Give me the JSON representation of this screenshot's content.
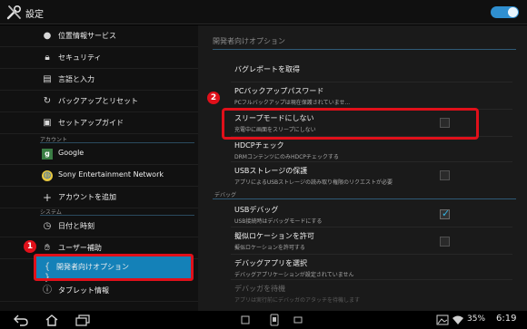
{
  "app": {
    "title": "設定",
    "icon": "wrench-screwdriver-icon",
    "master_switch": "on"
  },
  "colors": {
    "accent": "#1481b8",
    "highlight": "#e0101a",
    "toggle": "#2f8fd0"
  },
  "sidebar": {
    "items": [
      {
        "label": "位置情報サービス",
        "icon": "location-pin-icon"
      },
      {
        "label": "セキュリティ",
        "icon": "lock-icon"
      },
      {
        "label": "言語と入力",
        "icon": "keyboard-icon"
      },
      {
        "label": "バックアップとリセット",
        "icon": "reset-icon"
      },
      {
        "label": "セットアップガイド",
        "icon": "guide-icon"
      }
    ],
    "section_account": "アカウント",
    "account_items": [
      {
        "label": "Google",
        "icon": "google-icon"
      },
      {
        "label": "Sony Entertainment Network",
        "icon": "sony-network-icon"
      },
      {
        "label": "アカウントを追加",
        "icon": "plus-icon"
      }
    ],
    "section_system": "システム",
    "system_items": [
      {
        "label": "日付と時刻",
        "icon": "clock-icon"
      },
      {
        "label": "ユーザー補助",
        "icon": "hand-icon"
      },
      {
        "label": "開発者向けオプション",
        "icon": "braces-icon",
        "selected": true
      },
      {
        "label": "タブレット情報",
        "icon": "info-icon"
      }
    ]
  },
  "content": {
    "heading": "開発者向けオプション",
    "items": [
      {
        "title": "バグレポートを取得",
        "summary": ""
      },
      {
        "title": "PCバックアップパスワード",
        "summary": "PCフルバックアップは現在保護されていませ..."
      },
      {
        "title": "スリープモードにしない",
        "summary": "充電中に画面をスリープにしない",
        "checked": false
      },
      {
        "title": "HDCPチェック",
        "summary": "DRMコンテンツにのみHDCPチェックする"
      },
      {
        "title": "USBストレージの保護",
        "summary": "アプリによるUSBストレージの読み取り権限のリクエストが必要",
        "checked": false
      }
    ],
    "section_debug": "デバッグ",
    "debug_items": [
      {
        "title": "USBデバッグ",
        "summary": "USB接続時はデバッグモードにする",
        "checked": true
      },
      {
        "title": "擬似ロケーションを許可",
        "summary": "擬似ロケーションを許可する",
        "checked": false
      },
      {
        "title": "デバッグアプリを選択",
        "summary": "デバッグアプリケーションが設定されていません"
      },
      {
        "title": "デバッガを待機",
        "summary": "アプリは実行前にデバッガのアタッチを待機します",
        "disabled": true
      }
    ]
  },
  "annotations": {
    "step1": "1",
    "step2": "2"
  },
  "statusbar": {
    "battery": "35%",
    "time": "6:19"
  }
}
